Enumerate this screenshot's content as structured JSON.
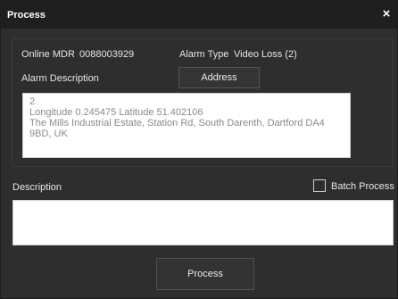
{
  "window": {
    "title": "Process",
    "close_glyph": "×"
  },
  "info": {
    "online_mdr_label": "Online MDR",
    "online_mdr_value": "0088003929",
    "alarm_type_label": "Alarm Type",
    "alarm_type_value": "Video Loss (2)",
    "alarm_description_label": "Alarm Description",
    "address_button": "Address",
    "alarm_description_lines": [
      "2",
      "Longitude 0.245475  Latitude 51.402106",
      "The Mills Industrial Estate, Station Rd, South Darenth, Dartford DA4",
      "9BD, UK"
    ]
  },
  "description": {
    "label": "Description",
    "value": "",
    "batch_process_label": "Batch Process",
    "batch_process_checked": false
  },
  "actions": {
    "process_button": "Process"
  },
  "colors": {
    "background": "#2e2e2e",
    "titlebar": "#1f1f1f",
    "text": "#e6e6e6",
    "field_background": "#ffffff",
    "field_text": "#8a8a8a"
  }
}
